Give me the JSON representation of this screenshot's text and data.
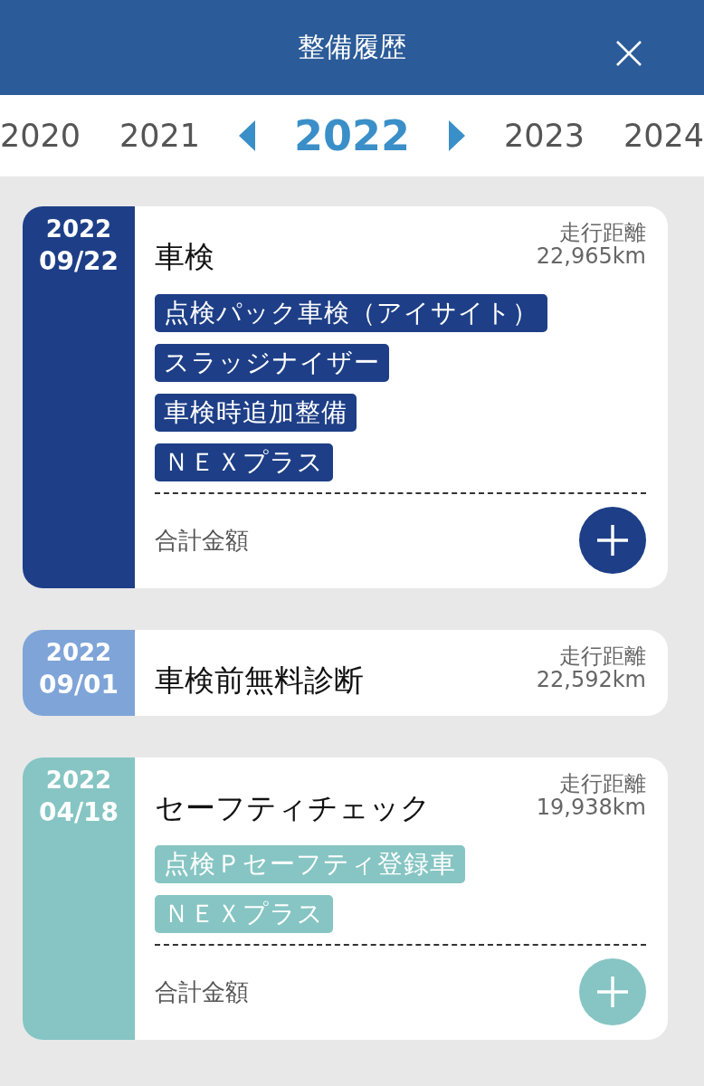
{
  "header": {
    "title": "整備履歴"
  },
  "years": [
    {
      "label": "2020",
      "selected": false
    },
    {
      "label": "2021",
      "selected": false
    },
    {
      "label": "2022",
      "selected": true
    },
    {
      "label": "2023",
      "selected": false
    },
    {
      "label": "2024",
      "selected": false
    }
  ],
  "records": [
    {
      "year": "2022",
      "date": "09/22",
      "title": "車検",
      "mileage_label": "走行距離",
      "mileage": "22,965km",
      "color": "#1e3f87",
      "tags": [
        "点検パック車検（アイサイト）",
        "スラッジナイザー",
        "車検時追加整備",
        "ＮＥＸプラス"
      ],
      "total_label": "合計金額"
    },
    {
      "year": "2022",
      "date": "09/01",
      "title": "車検前無料診断",
      "mileage_label": "走行距離",
      "mileage": "22,592km",
      "color": "#7fa4d8"
    },
    {
      "year": "2022",
      "date": "04/18",
      "title": "セーフティチェック",
      "mileage_label": "走行距離",
      "mileage": "19,938km",
      "color": "#86c5c3",
      "tags": [
        "点検Ｐセーフティ登録車",
        "ＮＥＸプラス"
      ],
      "total_label": "合計金額"
    }
  ]
}
